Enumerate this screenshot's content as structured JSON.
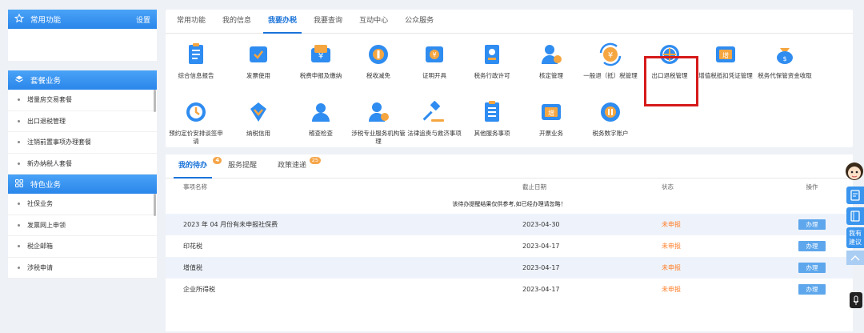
{
  "sidebar": {
    "common": {
      "title": "常用功能",
      "action": "设置"
    },
    "groups": [
      {
        "title": "套餐业务",
        "items": [
          "增量房交易套餐",
          "出口退税管理",
          "注销前置事项办理套餐",
          "新办纳税人套餐"
        ]
      },
      {
        "title": "特色业务",
        "items": [
          "社保业务",
          "发票网上申领",
          "税企邮箱",
          "涉税申请"
        ]
      }
    ]
  },
  "top_tabs": [
    "常用功能",
    "我的信息",
    "我要办税",
    "我要查询",
    "互动中心",
    "公众服务"
  ],
  "active_tab": "我要办税",
  "functions": [
    {
      "label": "综合信息报告",
      "icon": "report-icon"
    },
    {
      "label": "发票使用",
      "icon": "invoice-icon"
    },
    {
      "label": "税费申报及缴纳",
      "icon": "tax-payment-icon"
    },
    {
      "label": "税收减免",
      "icon": "tax-reduction-icon"
    },
    {
      "label": "证明开具",
      "icon": "certificate-icon"
    },
    {
      "label": "税务行政许可",
      "icon": "admin-permit-icon"
    },
    {
      "label": "核定管理",
      "icon": "assessment-icon"
    },
    {
      "label": "一般退（抵）税管理",
      "icon": "refund-icon"
    },
    {
      "label": "出口退税管理",
      "icon": "globe-icon"
    },
    {
      "label": "增值税抵扣凭证管理",
      "icon": "vat-voucher-icon"
    },
    {
      "label": "税务代保管资金收取",
      "icon": "money-bag-icon"
    },
    {
      "label": "预约定价安排谈签申请",
      "icon": "clock-icon"
    },
    {
      "label": "纳税信用",
      "icon": "credit-icon"
    },
    {
      "label": "稽查检查",
      "icon": "inspection-icon"
    },
    {
      "label": "涉税专业服务机构管理",
      "icon": "agency-icon"
    },
    {
      "label": "法律追责与救济事项",
      "icon": "gavel-icon"
    },
    {
      "label": "其他服务事项",
      "icon": "other-services-icon"
    },
    {
      "label": "开票业务",
      "icon": "invoicing-icon"
    },
    {
      "label": "税务数字账户",
      "icon": "digital-account-icon"
    }
  ],
  "todo": {
    "tabs": [
      {
        "label": "我的待办",
        "badge": "4"
      },
      {
        "label": "服务提醒",
        "badge": ""
      },
      {
        "label": "政策速递",
        "badge": "25"
      }
    ],
    "columns": [
      "事项名称",
      "截止日期",
      "状态",
      "操作"
    ],
    "notice": "该待办提醒结果仅供参考,如已经办理请忽略！",
    "rows": [
      {
        "name": "2023 年 04 月份有未申报社保费",
        "date": "2023-04-30",
        "status": "未申报",
        "action": "办理"
      },
      {
        "name": "印花税",
        "date": "2023-04-17",
        "status": "未申报",
        "action": "办理"
      },
      {
        "name": "增值税",
        "date": "2023-04-17",
        "status": "未申报",
        "action": "办理"
      },
      {
        "name": "企业所得税",
        "date": "2023-04-17",
        "status": "未申报",
        "action": "办理"
      }
    ]
  },
  "float_bar": {
    "chat_text": "我有建议"
  },
  "colors": {
    "primary": "#2a86ea",
    "status": "#ff7f2a",
    "highlight": "#d61a1a",
    "icon_orange": "#f5a640"
  }
}
